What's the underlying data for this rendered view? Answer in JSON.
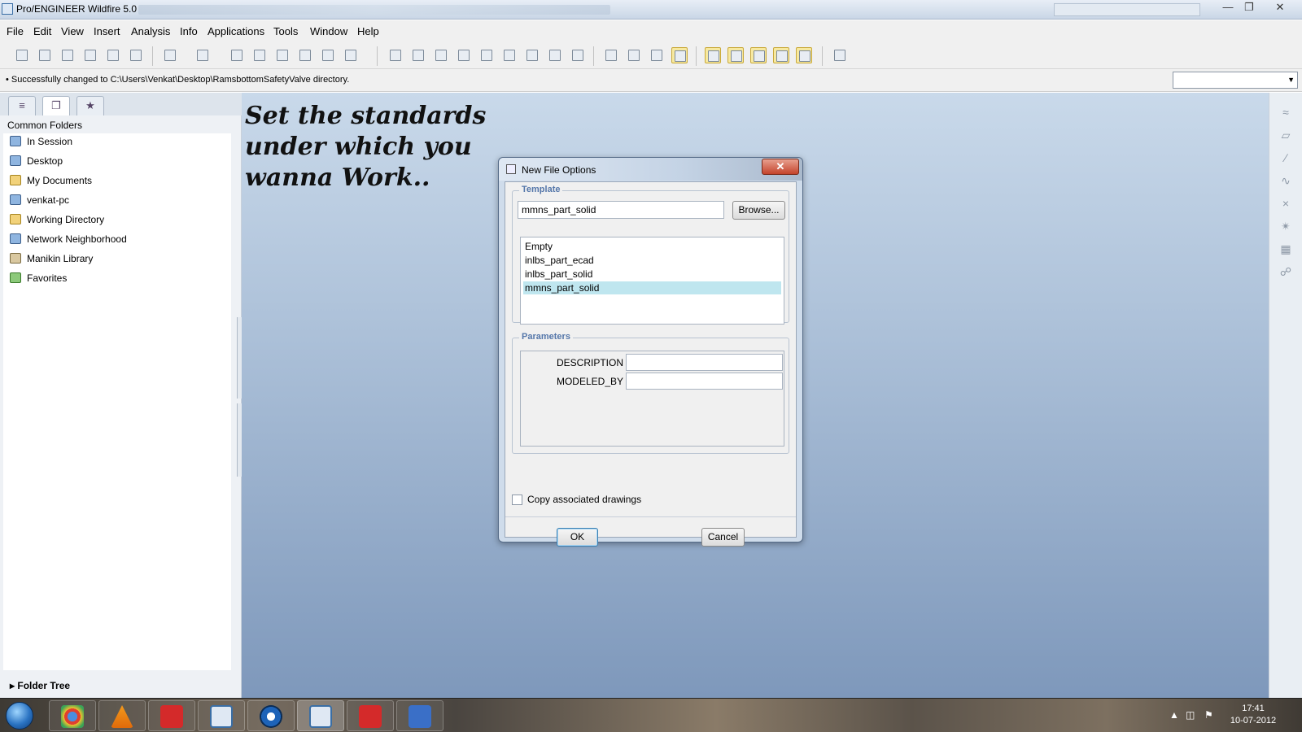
{
  "window": {
    "title": "Pro/ENGINEER Wildfire 5.0"
  },
  "menubar": {
    "items": [
      "File",
      "Edit",
      "View",
      "Insert",
      "Analysis",
      "Info",
      "Applications",
      "Tools",
      "Window",
      "Help"
    ]
  },
  "toolbar": {
    "icons": [
      "new-file-icon",
      "open-file-icon",
      "save-icon",
      "print-icon",
      "print-preview-icon",
      "plot-icon",
      "undo-icon",
      "redo-icon",
      "cut-icon",
      "copy-icon",
      "paste-icon",
      "paste-special-icon",
      "find-icon",
      "select-box-icon",
      "regenerate-icon",
      "model-tree-icon",
      "orient-icon",
      "zoom-in-icon",
      "zoom-out-icon",
      "refit-icon",
      "spin-center-icon",
      "saved-views-icon",
      "layers-icon",
      "wireframe-icon",
      "hidden-line-icon",
      "no-hidden-icon",
      "shading-icon",
      "datum-planes-icon",
      "datum-axes-icon",
      "datum-points-icon",
      "coordinate-systems-icon",
      "annotations-icon",
      "context-help-icon"
    ]
  },
  "message": {
    "text": "Successfully changed to C:\\Users\\Venkat\\Desktop\\RamsbottomSafetyValve directory."
  },
  "navigator": {
    "section_label": "Common Folders",
    "folders": [
      {
        "label": "In Session",
        "icon": "in-session-icon"
      },
      {
        "label": "Desktop",
        "icon": "desktop-icon"
      },
      {
        "label": "My Documents",
        "icon": "my-documents-icon"
      },
      {
        "label": "venkat-pc",
        "icon": "computer-icon"
      },
      {
        "label": "Working Directory",
        "icon": "working-directory-icon"
      },
      {
        "label": "Network Neighborhood",
        "icon": "network-icon"
      },
      {
        "label": "Manikin Library",
        "icon": "library-icon"
      },
      {
        "label": "Favorites",
        "icon": "favorites-icon"
      }
    ],
    "folder_tree_label": "Folder Tree"
  },
  "graphics": {
    "tagline": "Set the standards under which you wanna Work.."
  },
  "dialog": {
    "title": "New File Options",
    "template_group": "Template",
    "template_value": "mmns_part_solid",
    "browse_label": "Browse...",
    "templates": [
      "Empty",
      "inlbs_part_ecad",
      "inlbs_part_solid",
      "mmns_part_solid"
    ],
    "selected_template": "mmns_part_solid",
    "parameters_group": "Parameters",
    "parameters": [
      {
        "label": "DESCRIPTION",
        "value": ""
      },
      {
        "label": "MODELED_BY",
        "value": ""
      }
    ],
    "copy_drawings_label": "Copy associated drawings",
    "copy_drawings_checked": false,
    "ok_label": "OK",
    "cancel_label": "Cancel"
  },
  "taskbar": {
    "apps": [
      "chrome-icon",
      "vlc-icon",
      "solidworks-icon",
      "proe-icon",
      "media-player-icon",
      "proe-icon",
      "solidworks-icon",
      "app-icon"
    ],
    "time": "17:41",
    "date": "10-07-2012"
  }
}
